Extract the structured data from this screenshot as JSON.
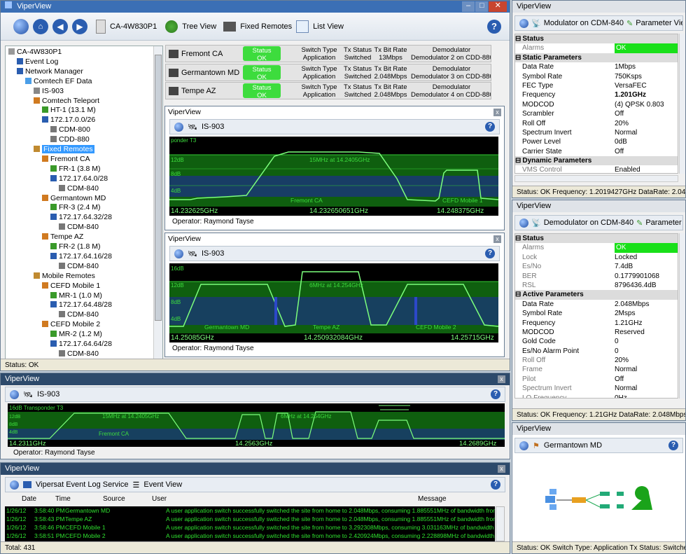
{
  "main": {
    "title": "ViperView",
    "breadcrumb": "CA-4W830P1",
    "tree_view": "Tree View",
    "fixed_remotes": "Fixed Remotes",
    "list_view": "List View",
    "status": "Status: OK"
  },
  "tree": [
    {
      "label": "CA-4W830P1",
      "level": 0,
      "icon": "computer-icon"
    },
    {
      "label": "Event Log",
      "level": 1,
      "icon": "book-icon"
    },
    {
      "label": "Network Manager",
      "level": 1,
      "icon": "network-icon"
    },
    {
      "label": "Comtech EF Data",
      "level": 2,
      "icon": "company-icon"
    },
    {
      "label": "IS-903",
      "level": 3,
      "icon": "satellite-icon"
    },
    {
      "label": "Comtech Teleport",
      "level": 3,
      "icon": "site-icon"
    },
    {
      "label": "HT-1 (13.1 M)",
      "level": 4,
      "icon": "router-icon"
    },
    {
      "label": "172.17.0.0/26",
      "level": 4,
      "icon": "subnet-icon"
    },
    {
      "label": "CDM-800",
      "level": 5,
      "icon": "modem-icon"
    },
    {
      "label": "CDD-880",
      "level": 5,
      "icon": "modem-icon"
    },
    {
      "label": "Fixed Remotes",
      "level": 3,
      "icon": "folder-icon",
      "selected": true
    },
    {
      "label": "Fremont CA",
      "level": 4,
      "icon": "site-icon"
    },
    {
      "label": "FR-1 (3.8 M)",
      "level": 5,
      "icon": "router-icon"
    },
    {
      "label": "172.17.64.0/28",
      "level": 5,
      "icon": "subnet-icon"
    },
    {
      "label": "CDM-840",
      "level": 6,
      "icon": "modem-icon"
    },
    {
      "label": "Germantown MD",
      "level": 4,
      "icon": "site-icon"
    },
    {
      "label": "FR-3 (2.4 M)",
      "level": 5,
      "icon": "router-icon"
    },
    {
      "label": "172.17.64.32/28",
      "level": 5,
      "icon": "subnet-icon"
    },
    {
      "label": "CDM-840",
      "level": 6,
      "icon": "modem-icon"
    },
    {
      "label": "Tempe AZ",
      "level": 4,
      "icon": "site-icon"
    },
    {
      "label": "FR-2 (1.8 M)",
      "level": 5,
      "icon": "router-icon"
    },
    {
      "label": "172.17.64.16/28",
      "level": 5,
      "icon": "subnet-icon"
    },
    {
      "label": "CDM-840",
      "level": 6,
      "icon": "modem-icon"
    },
    {
      "label": "Mobile Remotes",
      "level": 3,
      "icon": "folder-icon"
    },
    {
      "label": "CEFD Mobile 1",
      "level": 4,
      "icon": "site-icon"
    },
    {
      "label": "MR-1 (1.0 M)",
      "level": 5,
      "icon": "router-icon"
    },
    {
      "label": "172.17.64.48/28",
      "level": 5,
      "icon": "subnet-icon"
    },
    {
      "label": "CDM-840",
      "level": 6,
      "icon": "modem-icon"
    },
    {
      "label": "CEFD Mobile 2",
      "level": 4,
      "icon": "site-icon"
    },
    {
      "label": "MR-2 (1.2 M)",
      "level": 5,
      "icon": "router-icon"
    },
    {
      "label": "172.17.64.64/28",
      "level": 5,
      "icon": "subnet-icon"
    },
    {
      "label": "CDM-840",
      "level": 6,
      "icon": "modem-icon"
    }
  ],
  "gauges": [
    {
      "site": "Fremont CA",
      "status_label": "Status",
      "status": "OK",
      "sw_label": "Switch Type",
      "sw": "Application",
      "tx_label": "Tx Status",
      "tx": "Switched",
      "br_label": "Tx Bit Rate",
      "br": "13Mbps",
      "dm_label": "Demodulator",
      "dm": "Demodulator 2 on CDD-880"
    },
    {
      "site": "Germantown MD",
      "status_label": "Status",
      "status": "OK",
      "sw_label": "Switch Type",
      "sw": "Application",
      "tx_label": "Tx Status",
      "tx": "Switched",
      "br_label": "Tx Bit Rate",
      "br": "2.048Mbps",
      "dm_label": "Demodulator",
      "dm": "Demodulator 3 on CDD-880"
    },
    {
      "site": "Tempe AZ",
      "status_label": "Status",
      "status": "OK",
      "sw_label": "Switch Type",
      "sw": "Application",
      "tx_label": "Tx Status",
      "tx": "Switched",
      "br_label": "Tx Bit Rate",
      "br": "2.048Mbps",
      "dm_label": "Demodulator",
      "dm": "Demodulator 4 on CDD-880"
    }
  ],
  "spec1": {
    "title": "ViperView",
    "sat": "IS-903",
    "top": "ponder T3",
    "y1": "12dB",
    "y2": "8dB",
    "y3": "4dB",
    "carrier_label": "15MHz at 14.2405GHz",
    "sites": [
      "Fremont CA",
      "CEFD Mobile 1"
    ],
    "f_left": "14.232625GHz",
    "f_mid": "14.232650651GHz",
    "f_right": "14.248375GHz",
    "operator": "Operator: Raymond Tayse"
  },
  "spec2": {
    "title": "ViperView",
    "sat": "IS-903",
    "y0": "16dB",
    "y1": "12dB",
    "y2": "8dB",
    "y3": "4dB",
    "carrier_label": "6MHz at 14.254GHz",
    "sites": [
      "Germantown MD",
      "Tempe AZ",
      "CEFD Mobile 2"
    ],
    "f_left": "14.25085GHz",
    "f_mid": "14.250932084GHz",
    "f_right": "14.25715GHz",
    "operator": "Operator: Raymond Tayse"
  },
  "spec3": {
    "title": "ViperView",
    "sat": "IS-903",
    "top": "16dB Transponder T3",
    "y1": "12dB",
    "y2": "8dB",
    "y3": "4dB",
    "lbl1": "15MHz at 14.2405GHz",
    "lbl2": "6MHz at 14.254GHz",
    "site": "Fremont CA",
    "f_left": "14.2311GHz",
    "f_mid": "14.2563GHz",
    "f_right": "14.2689GHz",
    "operator": "Operator: Raymond Tayse"
  },
  "events": {
    "title": "ViperView",
    "service": "Vipersat Event Log Service",
    "view": "Event View",
    "headers": [
      "Date",
      "Time",
      "Source",
      "User",
      "Message"
    ],
    "rows": [
      [
        "1/26/12",
        "3:58:40 PM",
        "Germantown MD",
        "",
        "A user application switch successfully switched the site from home to 2.048Mbps, consuming 1.885551MHz of bandwidth from th"
      ],
      [
        "1/26/12",
        "3:58:43 PM",
        "Tempe AZ",
        "",
        "A user application switch successfully switched the site from home to 2.048Mbps, consuming 1.885551MHz of bandwidth from th"
      ],
      [
        "1/26/12",
        "3:58:46 PM",
        "CEFD Mobile 1",
        "",
        "A user application switch successfully switched the site from home to 3.292308Mbps, consuming 3.031163MHz of bandwidth fro"
      ],
      [
        "1/26/12",
        "3:58:51 PM",
        "CEFD Mobile 2",
        "",
        "A user application switch successfully switched the site from home to 2.420924Mbps, consuming 2.228898MHz of bandwidth fro"
      ]
    ],
    "total": "Total: 431"
  },
  "mod": {
    "title": "ViperView",
    "header": "Modulator on CDM-840",
    "pv": "Parameter View",
    "rows": [
      {
        "type": "sec",
        "k": "Status"
      },
      {
        "k": "Alarms",
        "v": "OK",
        "ok": true,
        "dim": true
      },
      {
        "type": "sec",
        "k": "Static Parameters"
      },
      {
        "k": "Data Rate",
        "v": "1Mbps"
      },
      {
        "k": "Symbol Rate",
        "v": "750Ksps"
      },
      {
        "k": "FEC Type",
        "v": "VersaFEC"
      },
      {
        "k": "Frequency",
        "v": "1.201GHz",
        "bold": true
      },
      {
        "k": "MODCOD",
        "v": "(4) QPSK 0.803"
      },
      {
        "k": "Scrambler",
        "v": "Off"
      },
      {
        "k": "Roll Off",
        "v": "20%"
      },
      {
        "k": "Spectrum Invert",
        "v": "Normal"
      },
      {
        "k": "Power Level",
        "v": "0dB"
      },
      {
        "k": "Carrier State",
        "v": "Off"
      },
      {
        "type": "sec",
        "k": "Dynamic Parameters"
      },
      {
        "k": "VMS Control",
        "v": "Enabled",
        "dim": true
      }
    ],
    "status": "Status: OK  Frequency: 1.2019427GHz  DataRate: 2.048Mbp"
  },
  "demod": {
    "title": "ViperView",
    "header": "Demodulator on CDM-840",
    "pv": "Parameter View",
    "rows": [
      {
        "type": "sec",
        "k": "Status"
      },
      {
        "k": "Alarms",
        "v": "OK",
        "ok": true,
        "dim": true
      },
      {
        "k": "Lock",
        "v": "Locked",
        "dim": true
      },
      {
        "k": "Es/No",
        "v": "7.4dB",
        "dim": true
      },
      {
        "k": "BER",
        "v": "0.1779901068",
        "dim": true
      },
      {
        "k": "RSL",
        "v": "8796436.4dB",
        "dim": true
      },
      {
        "type": "sec",
        "k": "Active Parameters"
      },
      {
        "k": "Data Rate",
        "v": "2.048Mbps"
      },
      {
        "k": "Symbol Rate",
        "v": "2Msps"
      },
      {
        "k": "Frequency",
        "v": "1.21GHz"
      },
      {
        "k": "MODCOD",
        "v": "Reserved"
      },
      {
        "k": "Gold Code",
        "v": "0"
      },
      {
        "k": "Es/No Alarm Point",
        "v": "0"
      },
      {
        "k": "Roll Off",
        "v": "20%",
        "dim": true
      },
      {
        "k": "Frame",
        "v": "Normal",
        "dim": true
      },
      {
        "k": "Pilot",
        "v": "Off",
        "dim": true
      },
      {
        "k": "Spectrum Invert",
        "v": "Normal",
        "dim": true
      },
      {
        "k": "LO Frequency",
        "v": "0Hz",
        "dim": true
      }
    ],
    "status": "Status: OK  Frequency: 1.21GHz  DataRate: 2.048Mbps  Pow"
  },
  "site": {
    "title": "ViperView",
    "header": "Germantown MD",
    "status": "Status: OK  Switch Type: Application  Tx Status: Switched"
  },
  "colors": {
    "grid_green": "#0f5f0f",
    "trace": "#7cff7c",
    "band_blue": "#1c2f8a",
    "status_ok": "#3ddc3d",
    "title_bar": "#2d4a6b"
  }
}
